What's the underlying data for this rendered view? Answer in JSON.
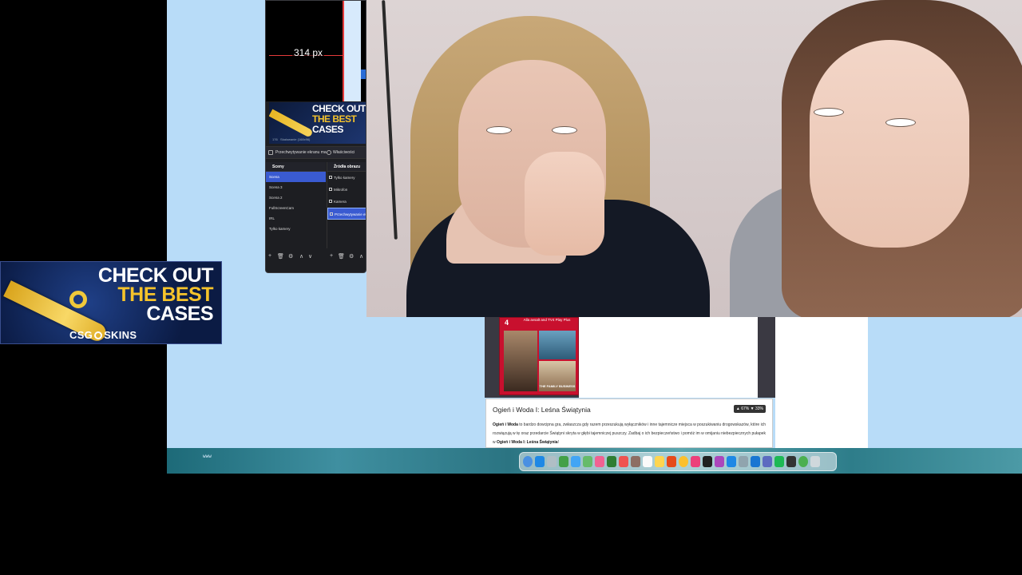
{
  "obs": {
    "preview_measurement": "314 px",
    "mini_ad": {
      "line1": "CHECK OUT",
      "line2": "THE BEST",
      "line3": "CASES",
      "caption_left": "176",
      "caption_right": "Skalowanie (168x96)"
    },
    "toolbar": {
      "item1": "Przechwytywanie ekranu ma",
      "item2": "Właściwości"
    },
    "scenes_title": "Sceny",
    "scenes": [
      "Scena",
      "Scena 3",
      "Scena 2",
      "FullScreenCam",
      "IRL",
      "Tylko kamery"
    ],
    "selected_scene_index": 0,
    "sources_title": "Źródła obrazu",
    "sources": [
      "Tylko kamery",
      "Mikrofon",
      "Kamera",
      "Przechwytywanie ekr"
    ],
    "selected_source_index": 3,
    "footer_buttons": [
      "+",
      "🗑",
      "⚙",
      "∧",
      "∨"
    ],
    "footer_buttons_right": [
      "+",
      "🗑",
      "⚙",
      "∧"
    ]
  },
  "ad": {
    "line1": "CHECK OUT",
    "line2": "THE BEST",
    "line3": "CASES",
    "brand_left": "CSG",
    "brand_right": "SKINS",
    "colors": {
      "accent": "#f5c32b",
      "background": "#0b1b44"
    }
  },
  "promo": {
    "number": "4",
    "text": "Alla avsalt and TV4 Play Plus",
    "poster_caption": "THE FAMILY BUSINESS"
  },
  "article": {
    "title": "Ogień i Woda I: Leśna Świątynia",
    "vote_up": "67%",
    "vote_down": "33%",
    "body_lead": "Ogień i Woda",
    "body": " to bardzo dowcipna gra, zwłaszcza gdy razem przeszukują wyłączników i inne tajemnicze miejsca w poszukiwaniu drogowskazów, które ich rozwiązują w tę oraz przedarcie Świątyni skryta w głębi tajemniczej puszczy. Zadbaj o ich bezpieczeństwo i pomóż im w omijaniu niebezpiecznych pułapek w ",
    "body_tail": "Ogień i Woda I: Leśna Świątynia",
    "body_end": "!"
  },
  "desktop": {
    "wallpaper_label": "www"
  },
  "dock": {
    "icons": [
      "finder-icon",
      "safari-icon",
      "launchpad-icon",
      "messages-icon",
      "mail-icon",
      "maps-icon",
      "photos-icon",
      "facetime-icon",
      "calendar-icon",
      "contacts-icon",
      "reminders-icon",
      "notes-icon",
      "brave-icon",
      "chrome-icon",
      "music-icon",
      "tv-icon",
      "podcasts-icon",
      "appstore-icon",
      "settings-icon",
      "zoom-icon",
      "discord-icon",
      "spotify-icon",
      "obs-icon",
      "chrome-alt-icon",
      "trash-icon"
    ],
    "colors": [
      "#4a90e2",
      "#1e88e5",
      "#b0bec5",
      "#43a047",
      "#42a5f5",
      "#66bb6a",
      "#f06292",
      "#2e7d32",
      "#ef5350",
      "#8d6e63",
      "#fafafa",
      "#ffd54f",
      "#e64a19",
      "#fbc02d",
      "#ec407a",
      "#212121",
      "#ab47bc",
      "#1e88e5",
      "#90a4ae",
      "#1976d2",
      "#5c6bc0",
      "#1db954",
      "#333333",
      "#4caf50",
      "#cfd8dc"
    ]
  }
}
